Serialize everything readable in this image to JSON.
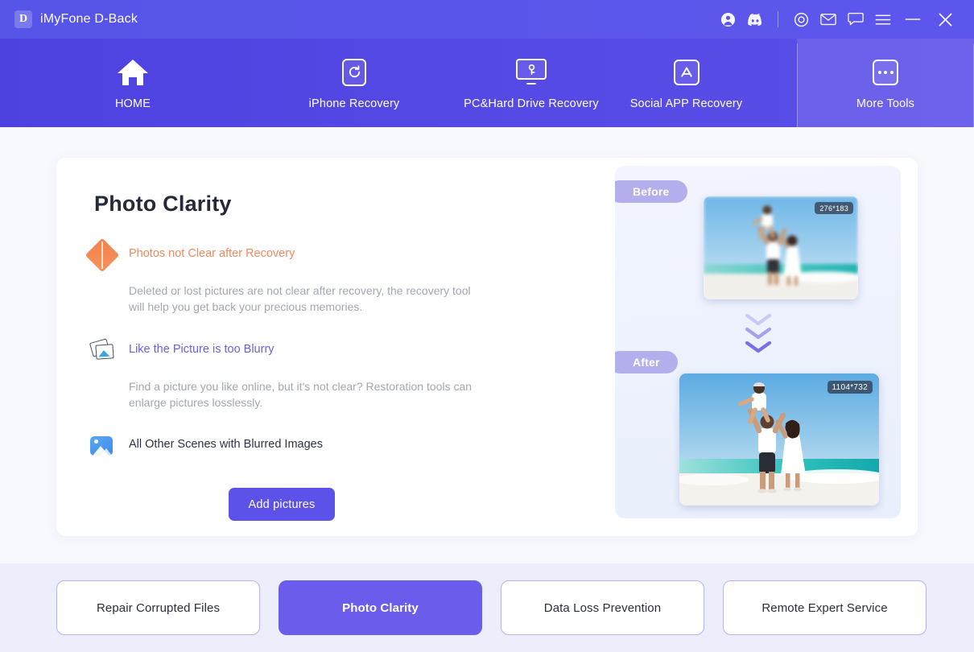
{
  "window": {
    "logo_letter": "D",
    "title": "iMyFone D-Back",
    "title_icons": [
      {
        "name": "account-icon",
        "glyph": "account"
      },
      {
        "name": "discord-icon",
        "glyph": "discord"
      },
      {
        "name": "target-icon",
        "glyph": "target"
      },
      {
        "name": "mail-icon",
        "glyph": "mail"
      },
      {
        "name": "chat-icon",
        "glyph": "chat"
      },
      {
        "name": "menu-icon",
        "glyph": "hamburger"
      },
      {
        "name": "minimize-button",
        "glyph": "minimize"
      },
      {
        "name": "close-button",
        "glyph": "close"
      }
    ]
  },
  "nav": {
    "items": [
      {
        "label": "HOME",
        "icon": "home-icon",
        "active": false
      },
      {
        "label": "iPhone Recovery",
        "icon": "phone-refresh-icon",
        "active": false
      },
      {
        "label": "PC&Hard Drive Recovery",
        "icon": "monitor-key-icon",
        "active": false
      },
      {
        "label": "Social APP Recovery",
        "icon": "app-store-icon",
        "active": false
      },
      {
        "label": "More Tools",
        "icon": "ellipsis-icon",
        "active": true
      }
    ]
  },
  "main": {
    "title": "Photo Clarity",
    "features": [
      {
        "icon": "orange-diamond-icon",
        "title": "Photos not Clear after Recovery",
        "description": "Deleted or lost pictures are not clear after recovery, the recovery tool will help you get back your precious memories."
      },
      {
        "icon": "photo-stack-icon",
        "title": "Like the Picture is too Blurry",
        "description": "Find a picture you like online, but it's not clear? Restoration tools can enlarge pictures losslessly."
      },
      {
        "icon": "blue-image-icon",
        "title": "All Other Scenes with Blurred Images",
        "description": ""
      }
    ],
    "add_button": "Add pictures"
  },
  "preview": {
    "before_label": "Before",
    "after_label": "After",
    "before_dimensions": "276*183",
    "after_dimensions": "1104*732"
  },
  "bottom_tabs": [
    {
      "label": "Repair Corrupted Files",
      "active": false
    },
    {
      "label": "Photo Clarity",
      "active": true
    },
    {
      "label": "Data Loss Prevention",
      "active": false
    },
    {
      "label": "Remote Expert Service",
      "active": false
    }
  ],
  "colors": {
    "brand_purple": "#5c51e8",
    "nav_gradient_start": "#4d41e0",
    "accent_orange": "#f4814a",
    "accent_blue": "#3d8ae8",
    "chip_lavender": "#b3aeec",
    "bottom_bar_bg": "#eceffb"
  }
}
